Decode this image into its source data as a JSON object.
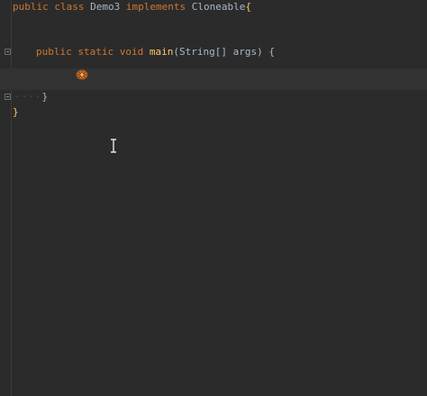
{
  "code": {
    "line1": {
      "kw_public": "public",
      "kw_class": "class",
      "class_name": "Demo3",
      "kw_implements": "implements",
      "interface_name": "Cloneable",
      "open_brace": "{"
    },
    "line2": {
      "indent_dots": "····",
      "kw_public": "public",
      "kw_static": "static",
      "kw_void": "void",
      "method_name": "main",
      "paren_open": "(",
      "param_type": "String[]",
      "param_name": "args",
      "paren_close": ")",
      "open_brace": "{"
    },
    "line3": {
      "indent_dots": "····",
      "close_brace": "}"
    },
    "line4": {
      "close_brace": "}"
    }
  },
  "icons": {
    "bug": "bug-icon",
    "cursor": "text-cursor-icon"
  },
  "colors": {
    "background": "#2b2b2b",
    "keyword": "#cc7832",
    "identifier": "#a9b7c6",
    "method": "#ffc66d"
  }
}
